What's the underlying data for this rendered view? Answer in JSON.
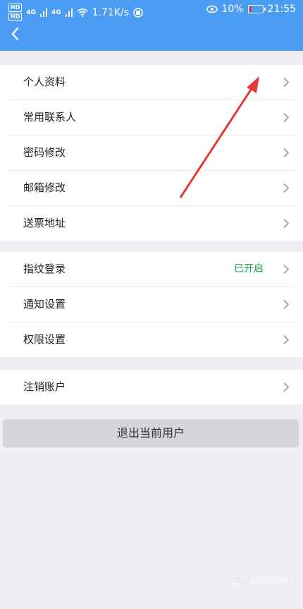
{
  "status_bar": {
    "hd1": "HD",
    "hd2": "HD",
    "signal1": "4G",
    "signal2": "4G",
    "net_speed": "1.71K/s",
    "battery_percent": "10%",
    "time": "21:55"
  },
  "header": {
    "back_icon": "chevron-left-icon"
  },
  "groups": [
    {
      "items": [
        {
          "label": "个人资料"
        },
        {
          "label": "常用联系人"
        },
        {
          "label": "密码修改"
        },
        {
          "label": "邮箱修改"
        },
        {
          "label": "送票地址"
        }
      ]
    },
    {
      "items": [
        {
          "label": "指纹登录",
          "value": "已开启"
        },
        {
          "label": "通知设置"
        },
        {
          "label": "权限设置"
        }
      ]
    },
    {
      "items": [
        {
          "label": "注销账户"
        }
      ]
    }
  ],
  "logout_button": "退出当前用户",
  "colors": {
    "header": "#4b9cf3",
    "enabled_value": "#1aa34a",
    "annotation_arrow": "#e53935"
  }
}
